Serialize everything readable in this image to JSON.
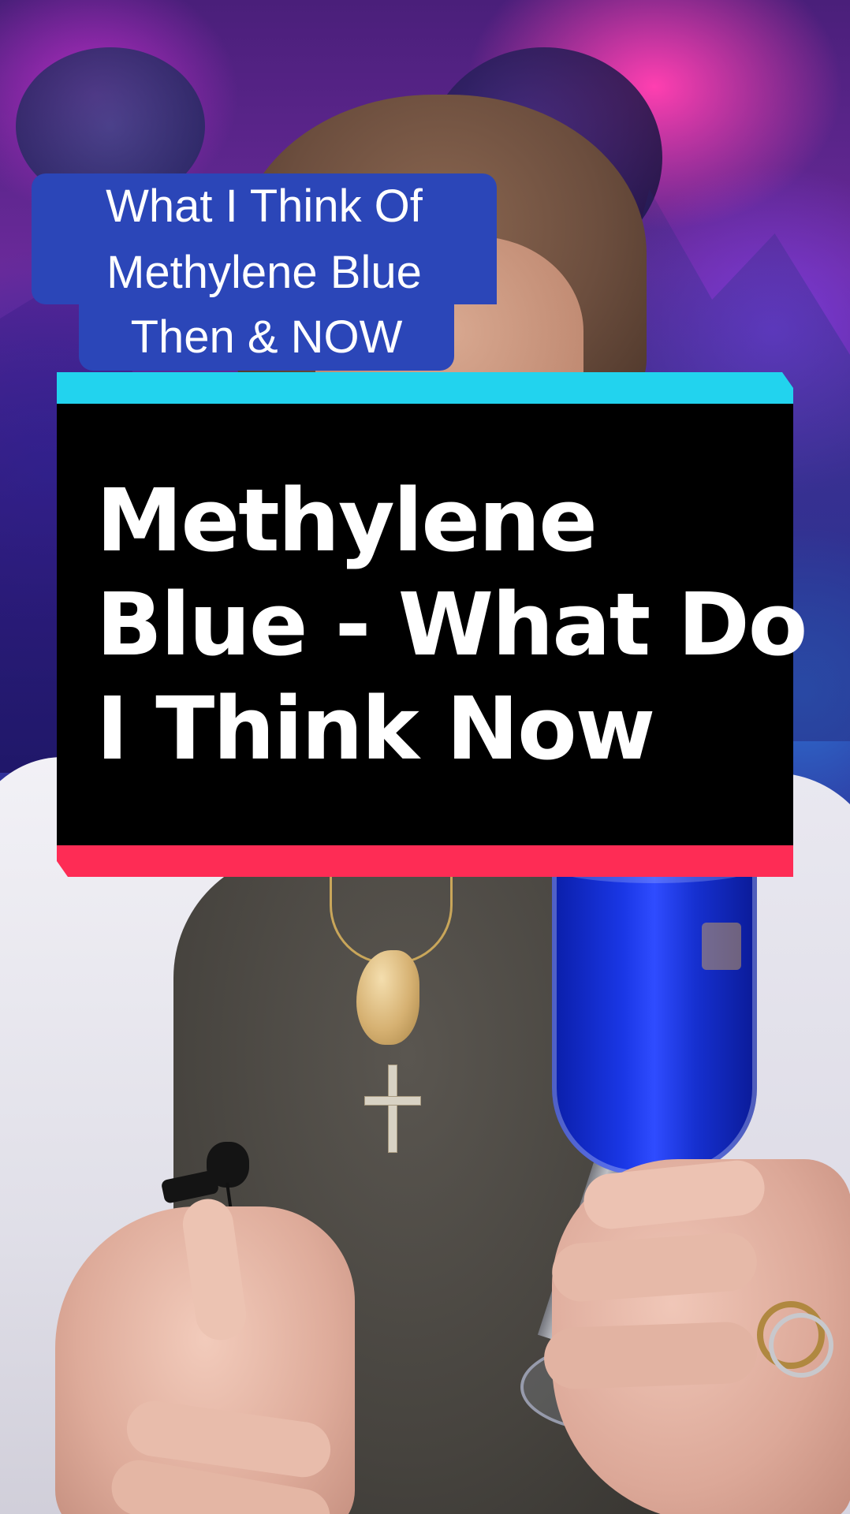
{
  "caption": {
    "lines": [
      "What I Think  Of",
      "Methylene Blue",
      "Then & NOW"
    ],
    "background_color": "#2b46b8",
    "text_color": "#ffffff"
  },
  "title_card": {
    "lines": [
      "Methylene",
      "Blue - What Do",
      "I Think Now"
    ],
    "top_band_color": "#22d3ee",
    "body_color": "#000000",
    "bottom_band_color": "#fe2c55",
    "text_color": "#ffffff"
  }
}
